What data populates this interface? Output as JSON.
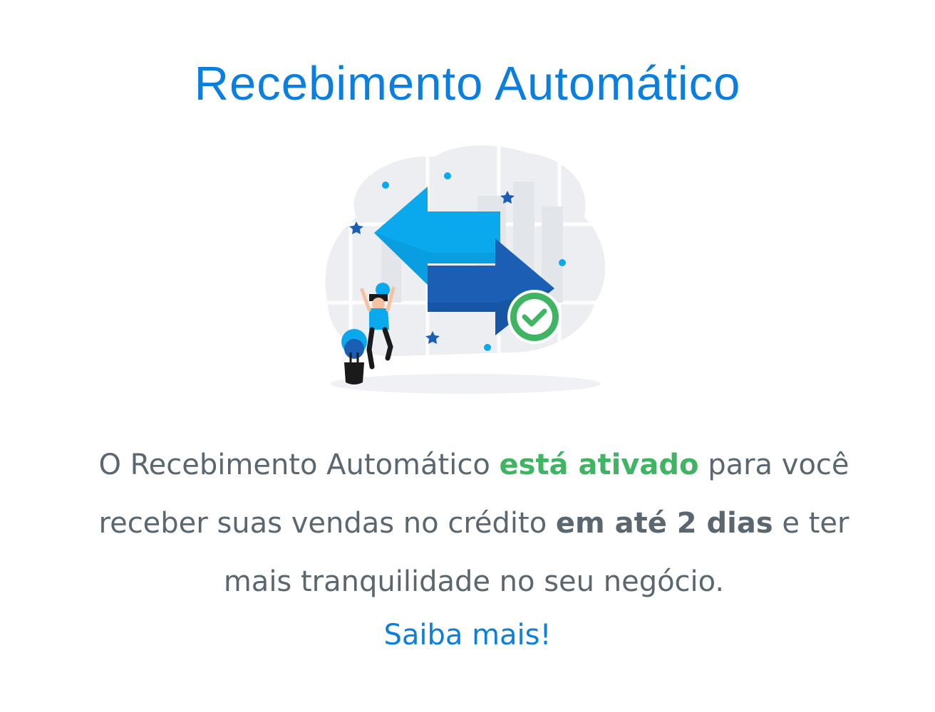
{
  "header": {
    "title": "Recebimento Automático"
  },
  "illustration": {
    "name": "transfer-arrows-illustration",
    "icons": [
      "arrow-left-icon",
      "arrow-right-icon",
      "check-circle-icon",
      "person-celebrating",
      "plant-pot",
      "star-icon"
    ],
    "colors": {
      "light_blue": "#0aa9ee",
      "dark_blue": "#1a5fb4",
      "green": "#3fb463",
      "cloud": "#eef0f4"
    }
  },
  "message": {
    "part1": "O Recebimento Automático ",
    "highlight": "está ativado",
    "part2": " para você receber suas vendas no crédito ",
    "bold": "em até 2 dias",
    "part3": " e ter mais tranquilidade no seu negócio."
  },
  "link": {
    "label": "Saiba mais!"
  },
  "colors": {
    "accent": "#0b7fe0",
    "success": "#3fb463",
    "text": "#5b6770"
  }
}
